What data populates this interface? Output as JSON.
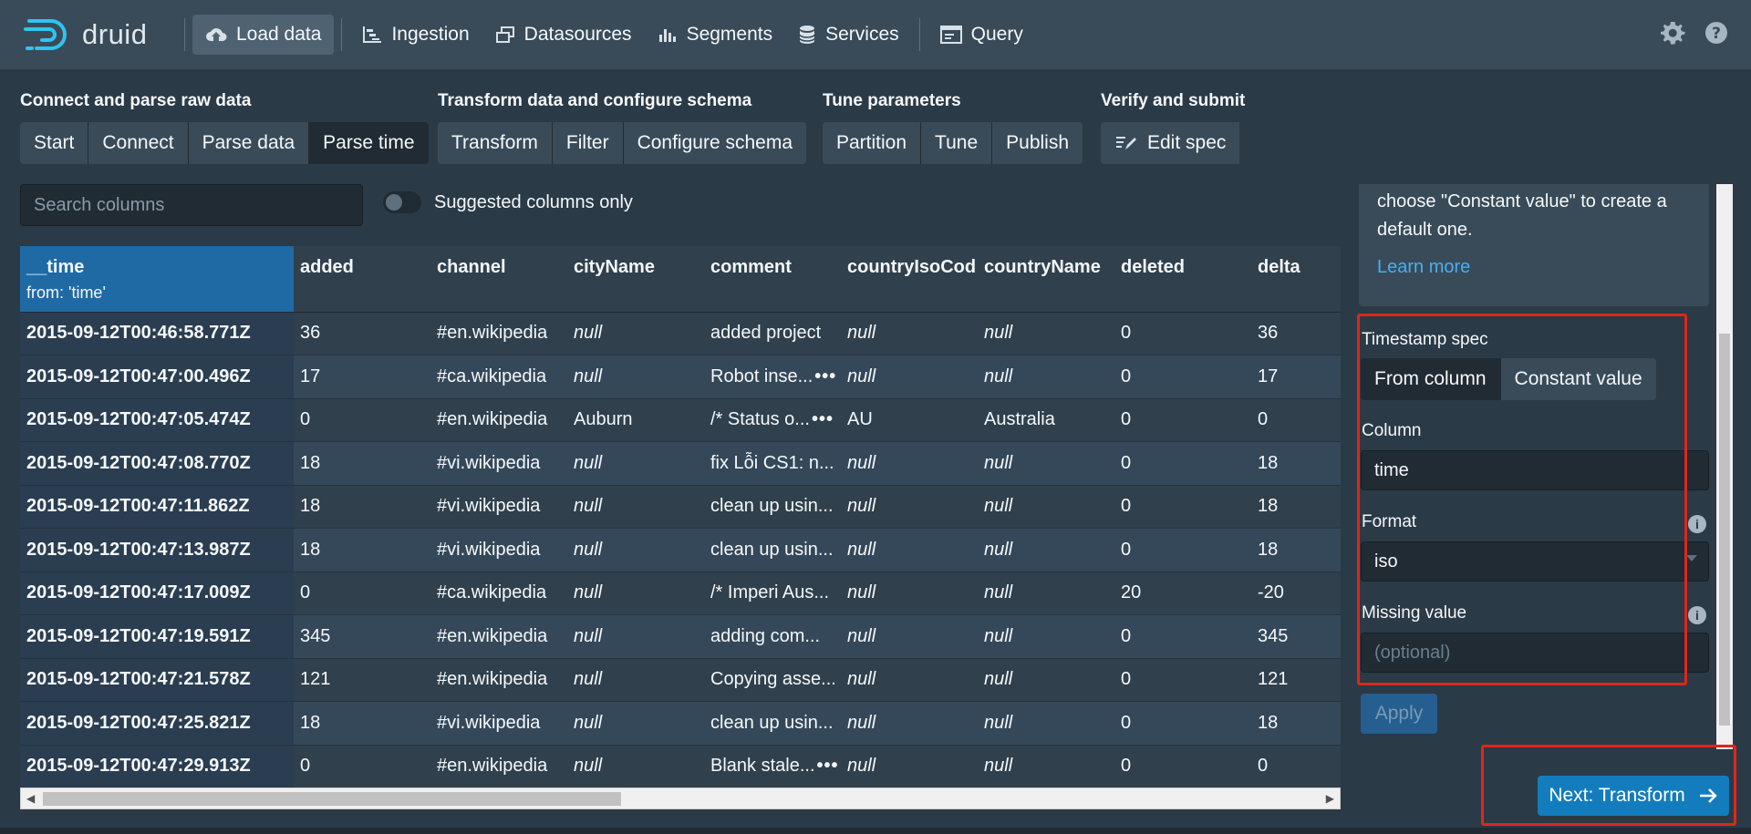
{
  "nav": {
    "logo_text": "druid",
    "items": [
      {
        "label": "Load data",
        "icon": "cloud-upload-icon"
      },
      {
        "label": "Ingestion",
        "icon": "gantt-chart-icon"
      },
      {
        "label": "Datasources",
        "icon": "multi-select-icon"
      },
      {
        "label": "Segments",
        "icon": "stacked-chart-icon"
      },
      {
        "label": "Services",
        "icon": "database-icon"
      },
      {
        "label": "Query",
        "icon": "application-icon"
      }
    ],
    "settings_icon": "gear-icon",
    "help_icon": "help-icon"
  },
  "steps": {
    "groups": [
      {
        "title": "Connect and parse raw data",
        "buttons": [
          "Start",
          "Connect",
          "Parse data",
          "Parse time"
        ]
      },
      {
        "title": "Transform data and configure schema",
        "buttons": [
          "Transform",
          "Filter",
          "Configure schema"
        ]
      },
      {
        "title": "Tune parameters",
        "buttons": [
          "Partition",
          "Tune",
          "Publish"
        ]
      },
      {
        "title": "Verify and submit",
        "buttons": [
          "Edit spec"
        ]
      }
    ],
    "active": "Parse time"
  },
  "search": {
    "placeholder": "Search columns"
  },
  "toggle": {
    "label": "Suggested columns only"
  },
  "table": {
    "columns": [
      "__time",
      "added",
      "channel",
      "cityName",
      "comment",
      "countryIsoCod",
      "countryName",
      "deleted",
      "delta"
    ],
    "time_sub": "from: 'time'",
    "rows": [
      [
        "2015-09-12T00:46:58.771Z",
        "36",
        "#en.wikipedia",
        "null",
        "added project",
        "null",
        "null",
        "0",
        "36"
      ],
      [
        "2015-09-12T00:47:00.496Z",
        "17",
        "#ca.wikipedia",
        "null",
        "Robot inse...",
        "null",
        "null",
        "0",
        "17"
      ],
      [
        "2015-09-12T00:47:05.474Z",
        "0",
        "#en.wikipedia",
        "Auburn",
        "/* Status o...",
        "AU",
        "Australia",
        "0",
        "0"
      ],
      [
        "2015-09-12T00:47:08.770Z",
        "18",
        "#vi.wikipedia",
        "null",
        "fix Lỗi CS1: n...",
        "null",
        "null",
        "0",
        "18"
      ],
      [
        "2015-09-12T00:47:11.862Z",
        "18",
        "#vi.wikipedia",
        "null",
        "clean up usin...",
        "null",
        "null",
        "0",
        "18"
      ],
      [
        "2015-09-12T00:47:13.987Z",
        "18",
        "#vi.wikipedia",
        "null",
        "clean up usin...",
        "null",
        "null",
        "0",
        "18"
      ],
      [
        "2015-09-12T00:47:17.009Z",
        "0",
        "#ca.wikipedia",
        "null",
        "/* Imperi Aus...",
        "null",
        "null",
        "20",
        "-20"
      ],
      [
        "2015-09-12T00:47:19.591Z",
        "345",
        "#en.wikipedia",
        "null",
        "adding com...",
        "null",
        "null",
        "0",
        "345"
      ],
      [
        "2015-09-12T00:47:21.578Z",
        "121",
        "#en.wikipedia",
        "null",
        "Copying asse...",
        "null",
        "null",
        "0",
        "121"
      ],
      [
        "2015-09-12T00:47:25.821Z",
        "18",
        "#vi.wikipedia",
        "null",
        "clean up usin...",
        "null",
        "null",
        "0",
        "18"
      ],
      [
        "2015-09-12T00:47:29.913Z",
        "0",
        "#en.wikipedia",
        "null",
        "Blank stale...",
        "null",
        "null",
        "0",
        "0"
      ]
    ],
    "dots_rows": [
      1,
      2,
      10
    ],
    "dots_label": "•••"
  },
  "panel": {
    "callout_text": "choose \"Constant value\" to create a default one.",
    "learn_more": "Learn more",
    "timestamp_spec_label": "Timestamp spec",
    "timestamp_options": [
      "From column",
      "Constant value"
    ],
    "timestamp_selected": "From column",
    "column_label": "Column",
    "column_value": "time",
    "format_label": "Format",
    "format_value": "iso",
    "missing_label": "Missing value",
    "missing_placeholder": "(optional)",
    "info_icon": "info-icon",
    "apply_label": "Apply",
    "next_label": "Next: Transform",
    "next_icon": "arrow-right-icon"
  },
  "colors": {
    "background": "#2b3a47",
    "nav": "#394b59",
    "accent": "#137cbd",
    "highlight_box": "#e0251c"
  }
}
